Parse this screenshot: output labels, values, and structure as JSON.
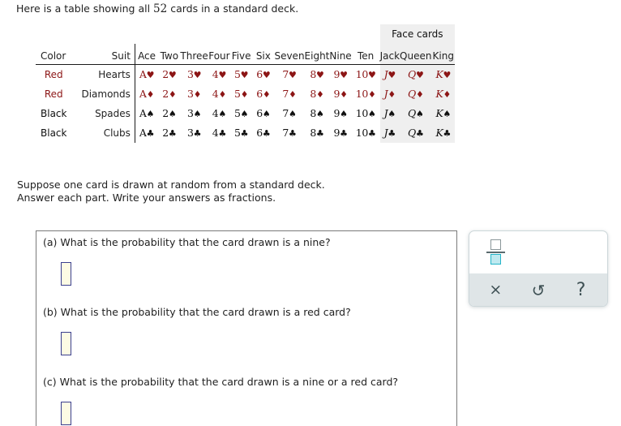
{
  "intro": {
    "before": "Here is a table showing all ",
    "count": "52",
    "after": " cards in a standard deck."
  },
  "table": {
    "group_header": "Face cards",
    "headers": {
      "color": "Color",
      "suit": "Suit",
      "ranks": [
        "Ace",
        "Two",
        "Three",
        "Four",
        "Five",
        "Six",
        "Seven",
        "Eight",
        "Nine",
        "Ten",
        "Jack",
        "Queen",
        "King"
      ]
    },
    "face_rank_start_index": 10,
    "rows": [
      {
        "color": "Red",
        "suit": "Hearts",
        "color_class": "red",
        "pip": "♥",
        "cards": [
          "A",
          "2",
          "3",
          "4",
          "5",
          "6",
          "7",
          "8",
          "9",
          "10",
          "J",
          "Q",
          "K"
        ]
      },
      {
        "color": "Red",
        "suit": "Diamonds",
        "color_class": "red",
        "pip": "♦",
        "cards": [
          "A",
          "2",
          "3",
          "4",
          "5",
          "6",
          "7",
          "8",
          "9",
          "10",
          "J",
          "Q",
          "K"
        ]
      },
      {
        "color": "Black",
        "suit": "Spades",
        "color_class": "black",
        "pip": "♠",
        "cards": [
          "A",
          "2",
          "3",
          "4",
          "5",
          "6",
          "7",
          "8",
          "9",
          "10",
          "J",
          "Q",
          "K"
        ]
      },
      {
        "color": "Black",
        "suit": "Clubs",
        "color_class": "black",
        "pip": "♣",
        "cards": [
          "A",
          "2",
          "3",
          "4",
          "5",
          "6",
          "7",
          "8",
          "9",
          "10",
          "J",
          "Q",
          "K"
        ]
      }
    ]
  },
  "prompt": {
    "line1": "Suppose one card is drawn at random from a standard deck.",
    "line2": "Answer each part. Write your answers as fractions."
  },
  "questions": [
    {
      "label": "(a) What is the probability that the card drawn is a nine?",
      "answer": ""
    },
    {
      "label": "(b) What is the probability that the card drawn is a red card?",
      "answer": ""
    },
    {
      "label": "(c) What is the probability that the card drawn is a nine or a red card?",
      "answer": ""
    }
  ],
  "tool": {
    "fraction_label": "fraction-template",
    "clear": "×",
    "undo": "↺",
    "help": "?"
  },
  "colors": {
    "red_suit": "#8c1515",
    "black_suit": "#101010",
    "face_bg": "#efefef",
    "answer_border": "#3b3f8f",
    "answer_fill": "#fdfbe4",
    "tool_bar_bg": "#dfe5e7",
    "fraction_accent": "#23b4c8"
  }
}
